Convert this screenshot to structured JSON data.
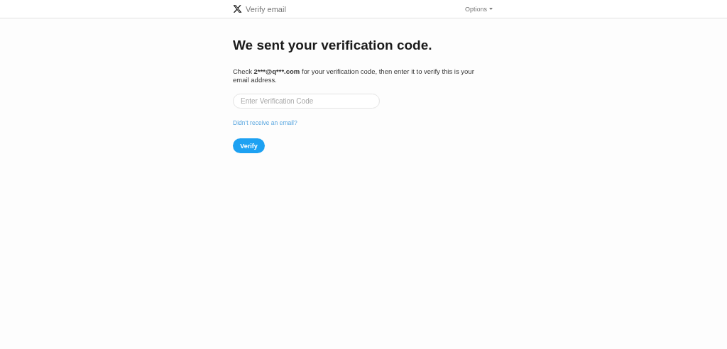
{
  "header": {
    "title": "Verify email",
    "menu": "Options"
  },
  "heading": "We sent your verification code.",
  "message": {
    "before": "Check ",
    "email": "2***@q***.com",
    "after": " for your verification code, then enter it to verify this is your email address."
  },
  "code_field": {
    "placeholder": "Enter Verification Code"
  },
  "resend_link": "Didn’t receive an email?",
  "button": "Verify"
}
